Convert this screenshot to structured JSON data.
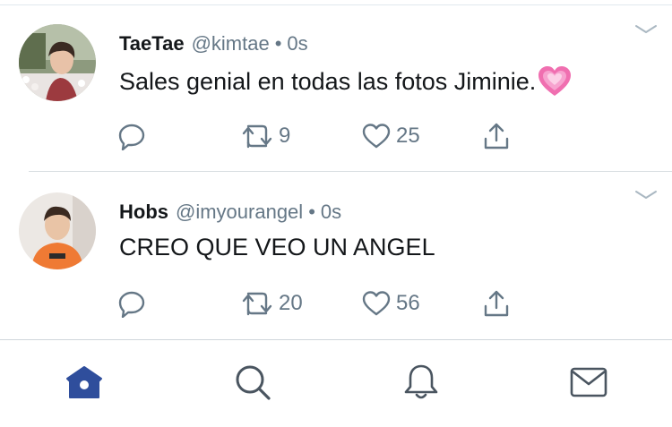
{
  "colors": {
    "accent": "#1da1f2",
    "home_active": "#2f4e9c",
    "secondary_text": "#657786",
    "icon_gray": "#4a5560"
  },
  "tweets": [
    {
      "name": "TaeTae",
      "handle": "@kimtae",
      "separator": "•",
      "time": "0s",
      "text": "Sales genial en todas las fotos Jiminie.",
      "emoji": "growing-heart-emoji",
      "retweets": "9",
      "likes": "25"
    },
    {
      "name": "Hobs",
      "handle": "@imyourangel",
      "separator": "•",
      "time": "0s",
      "text": "CREO QUE VEO UN ANGEL",
      "retweets": "20",
      "likes": "56"
    }
  ],
  "tabbar": {
    "active": "home",
    "items": [
      "home-icon",
      "search-icon",
      "bell-icon",
      "mail-icon"
    ]
  }
}
